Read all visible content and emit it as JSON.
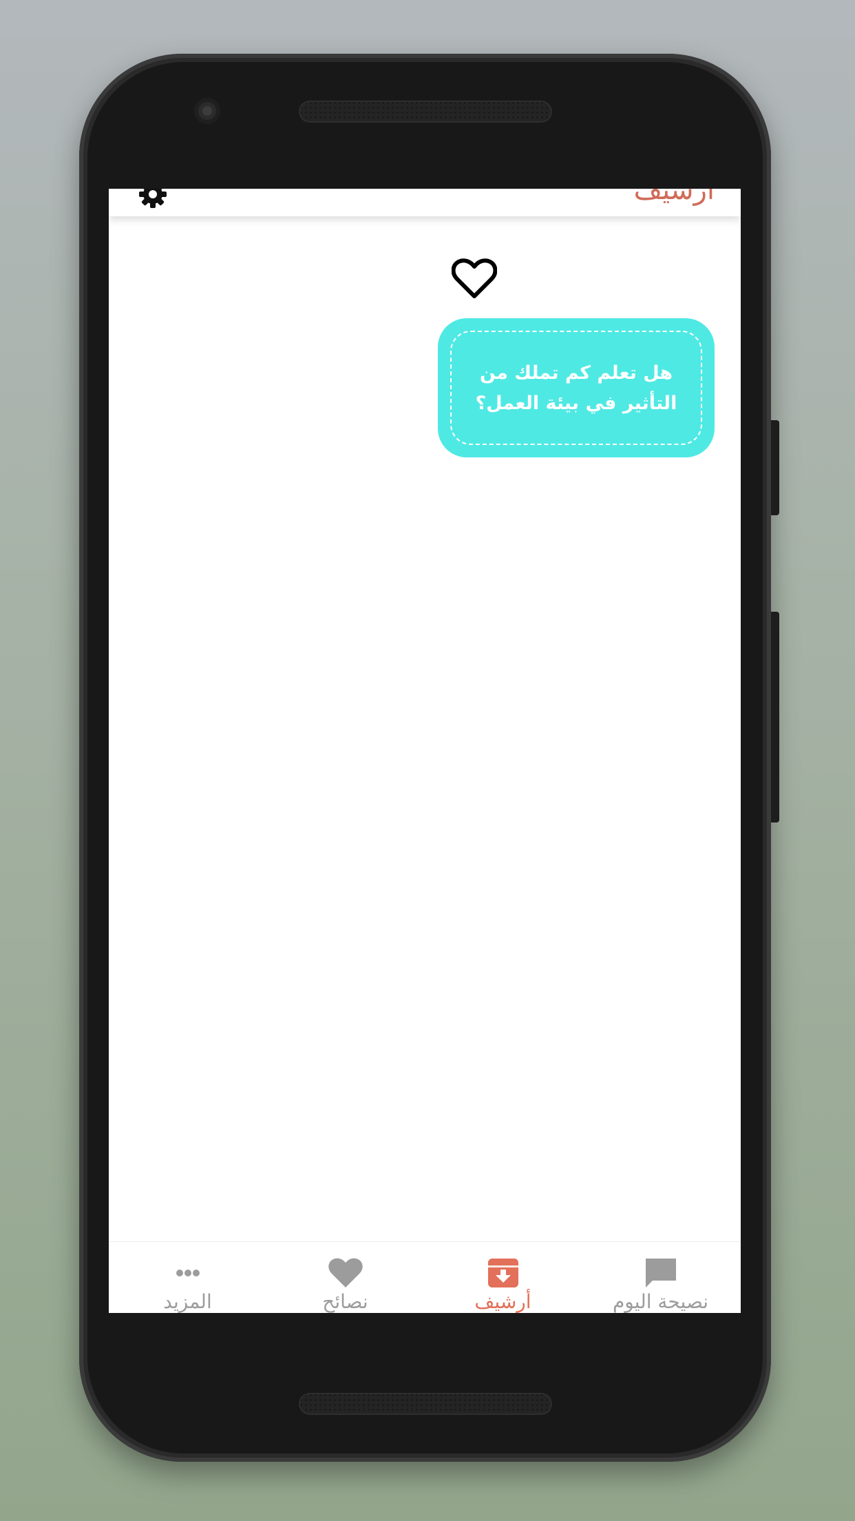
{
  "appbar": {
    "title": "أرشيف"
  },
  "card": {
    "text": "هل تعلم كم تملك من التأثير في بيئة العمل؟"
  },
  "bottom_nav": {
    "items": [
      {
        "label": "المزيد",
        "icon": "more-dots-icon",
        "active": false
      },
      {
        "label": "نصائح",
        "icon": "heart-icon",
        "active": false
      },
      {
        "label": "أرشيف",
        "icon": "archive-box-icon",
        "active": true
      },
      {
        "label": "نصيحة اليوم",
        "icon": "chat-bubble-icon",
        "active": false
      }
    ]
  },
  "colors": {
    "accent": "#e2705a",
    "card": "#4fe9e4",
    "inactive": "#9c9c9c"
  }
}
